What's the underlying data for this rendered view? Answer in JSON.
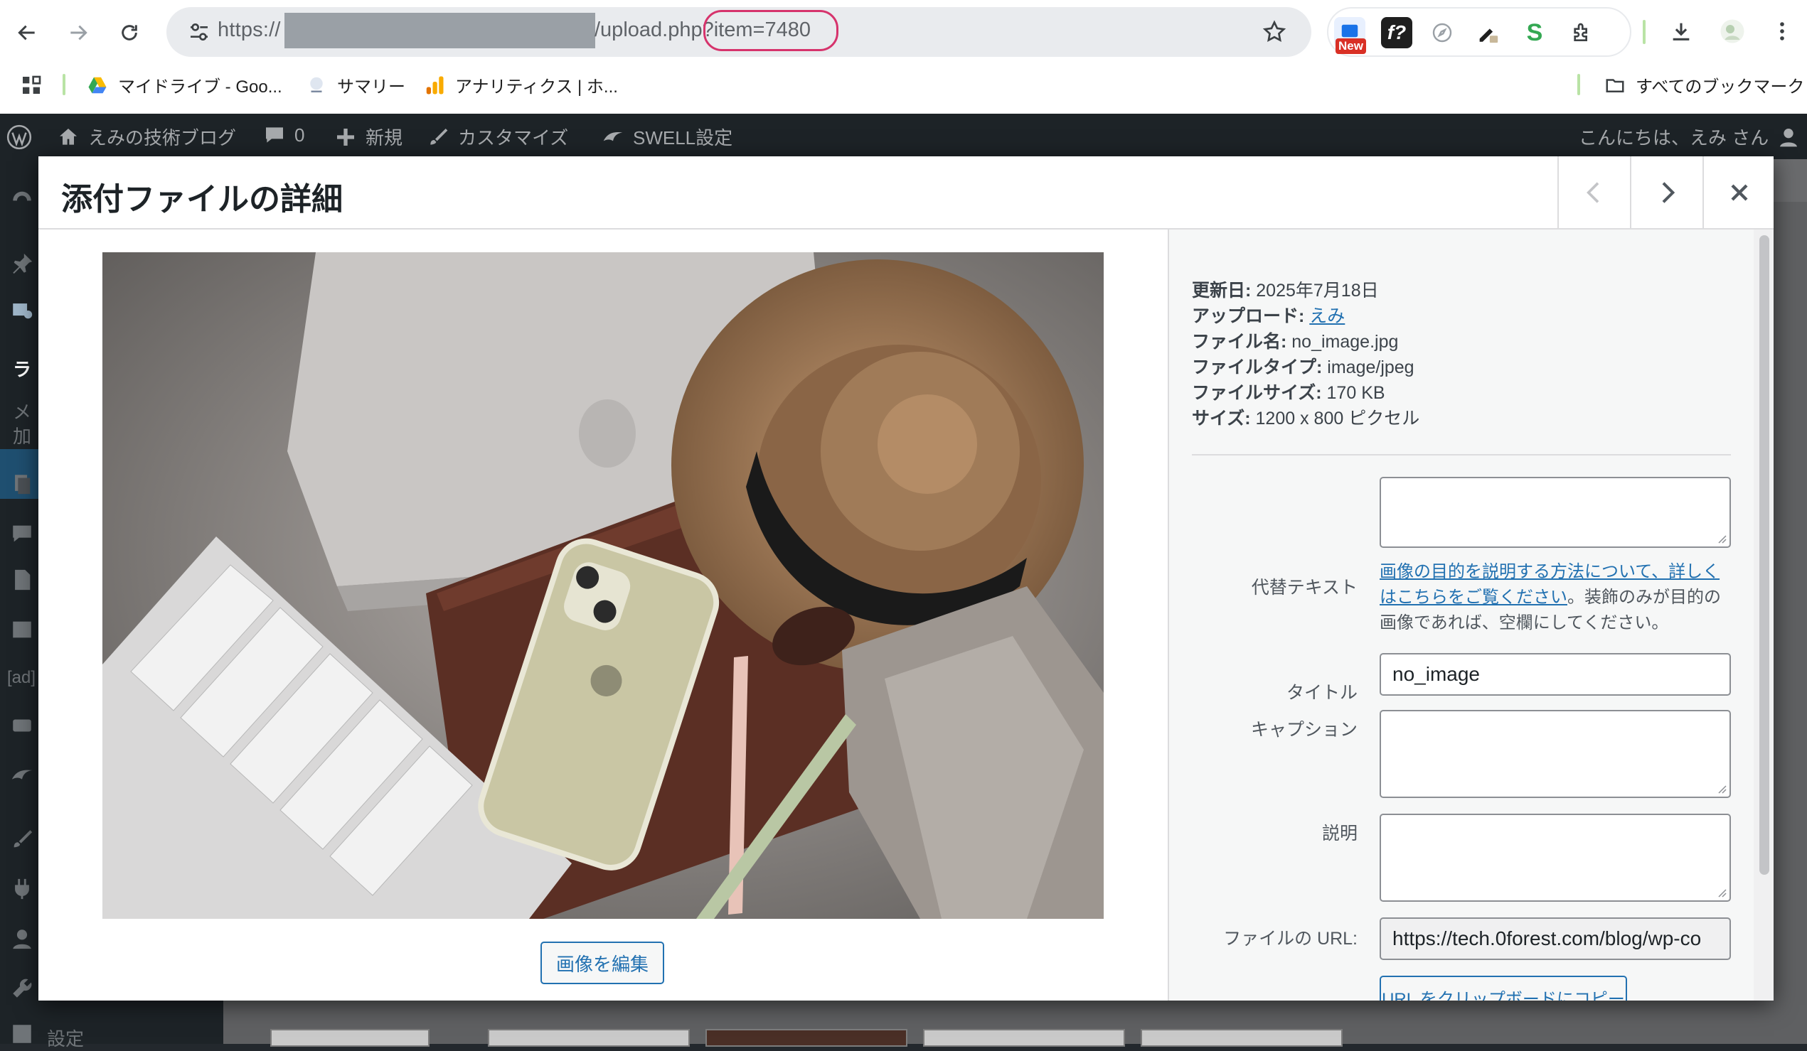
{
  "browser": {
    "url_prefix": "https://",
    "url_path": "/upload.php",
    "url_query": "?item=7480",
    "new_badge": "New",
    "bookmarks": [
      {
        "label": "マイドライブ - Goo..."
      },
      {
        "label": "サマリー"
      },
      {
        "label": "アナリティクス | ホ..."
      }
    ],
    "all_bookmarks": "すべてのブックマーク"
  },
  "adminbar": {
    "site_name": "えみの技術ブログ",
    "comments_count": "0",
    "new_label": "新規",
    "customize_label": "カスタマイズ",
    "swell_label": "SWELL設定",
    "greeting": "こんにちは、えみ さん"
  },
  "sidebar": {
    "text_la": "ラ",
    "text_me": "メ",
    "text_ka": "加",
    "text_ad": "[ad]",
    "settings": "設定"
  },
  "modal": {
    "title": "添付ファイルの詳細",
    "edit_image_button": "画像を編集"
  },
  "meta": {
    "updated_label": "更新日:",
    "updated_value": "2025年7月18日",
    "uploader_label": "アップロード:",
    "uploader_value": "えみ",
    "filename_label": "ファイル名:",
    "filename_value": "no_image.jpg",
    "filetype_label": "ファイルタイプ:",
    "filetype_value": "image/jpeg",
    "filesize_label": "ファイルサイズ:",
    "filesize_value": "170 KB",
    "dimensions_label": "サイズ:",
    "dimensions_value": "1200 x 800 ピクセル"
  },
  "fields": {
    "alt_label": "代替テキスト",
    "alt_value": "",
    "alt_help_link": "画像の目的を説明する方法について、詳しくはこちらをご覧ください",
    "alt_help_rest": "。装飾のみが目的の画像であれば、空欄にしてください。",
    "title_label": "タイトル",
    "title_value": "no_image",
    "caption_label": "キャプション",
    "caption_value": "",
    "description_label": "説明",
    "description_value": "",
    "url_label": "ファイルの URL:",
    "url_value": "https://tech.0forest.com/blog/wp-co",
    "copy_button": "URL をクリップボードにコピー"
  },
  "colors": {
    "wp_blue": "#2271b1",
    "adminbar_bg": "#1d2327",
    "highlight_ring": "#d6336c"
  }
}
